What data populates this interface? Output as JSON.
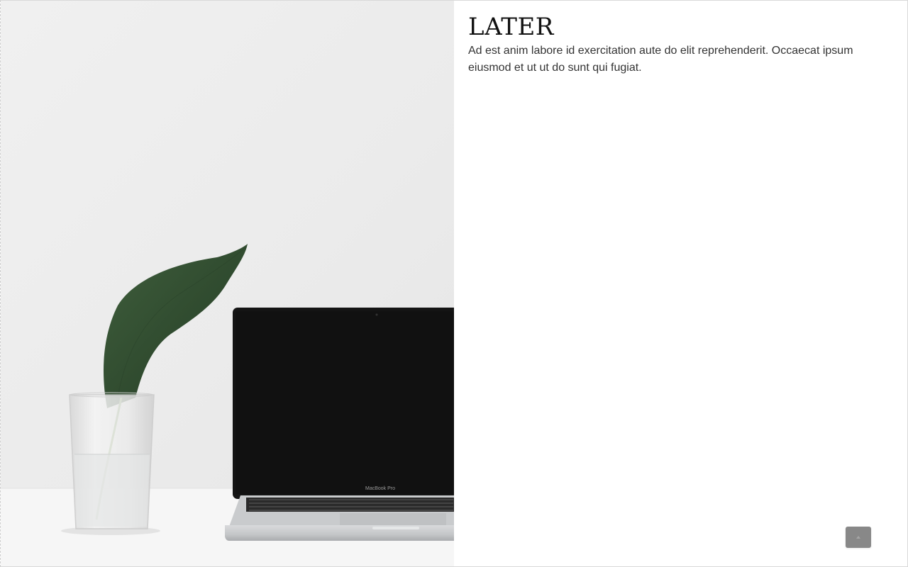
{
  "hero": {
    "image_name": "plant-and-laptop-photo",
    "laptop_label": "MacBook Pro"
  },
  "article": {
    "title": "LATER",
    "body": "Ad est anim labore id exercitation aute do elit reprehenderit. Occaecat ipsum eiusmod et ut ut do sunt qui fugiat."
  },
  "back_to_top": {
    "icon": "arrow-up-icon",
    "color": "#888888"
  }
}
